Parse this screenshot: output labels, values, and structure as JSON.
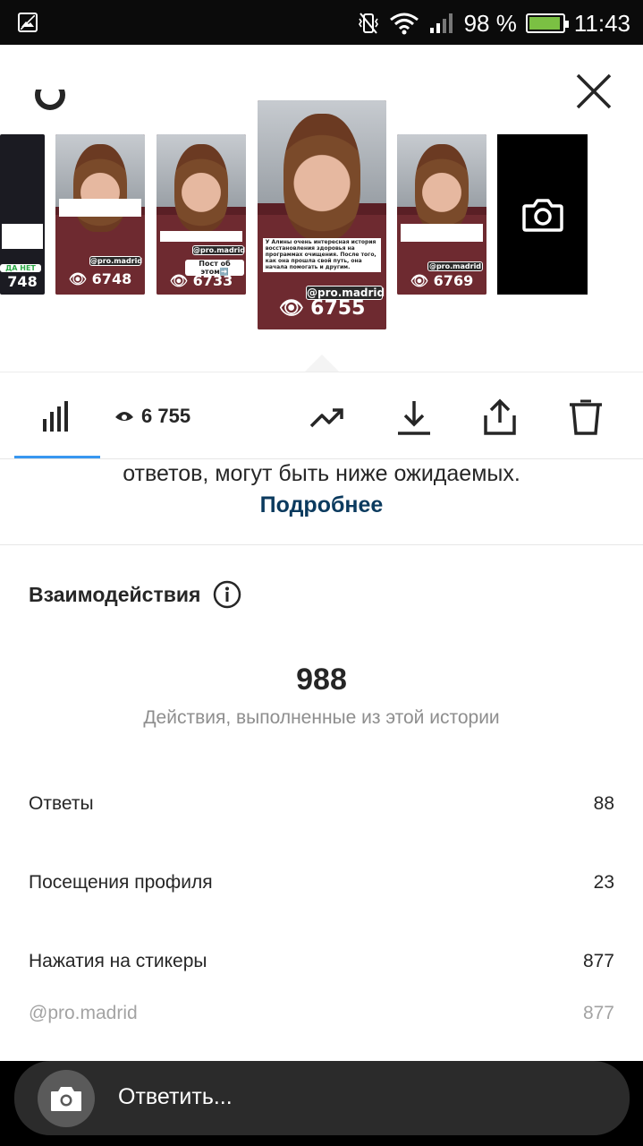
{
  "status_bar": {
    "battery_percent": "98 %",
    "time": "11:43"
  },
  "stories": {
    "thumbs": [
      {
        "views": "748",
        "tag": "",
        "caption": "",
        "buttons": "ДА    НЕТ"
      },
      {
        "views": "6748",
        "tag": "@pro.madrid",
        "caption": "",
        "buttons": ""
      },
      {
        "views": "6733",
        "tag": "@pro.madrid",
        "caption": "",
        "buttons": "Пост об этом➡️"
      },
      {
        "views": "6755",
        "tag": "@pro.madrid",
        "caption": "У Алины очень интересная история восстановления здоровья на программах очищения. После того, как она прошла свой путь, она начала помогать и другим.",
        "buttons": ""
      },
      {
        "views": "6769",
        "tag": "@pro.madrid",
        "caption": "",
        "buttons": ""
      }
    ]
  },
  "toolbar": {
    "views": "6 755",
    "icons": [
      "bar-chart-icon",
      "eye-icon",
      "trending-icon",
      "download-icon",
      "share-icon",
      "trash-icon"
    ]
  },
  "disclaimer": {
    "line1": "ответов, могут быть ниже ожидаемых.",
    "link": "Подробнее"
  },
  "interactions": {
    "title": "Взаимодействия",
    "total": "988",
    "subtitle": "Действия, выполненные из этой истории",
    "rows": [
      {
        "label": "Ответы",
        "value": "88"
      },
      {
        "label": "Посещения профиля",
        "value": "23"
      },
      {
        "label": "Нажатия на стикеры",
        "value": "877"
      },
      {
        "label": "@pro.madrid",
        "value": "877"
      }
    ]
  },
  "reply": {
    "placeholder": "Ответить..."
  },
  "colors": {
    "accent": "#3897f0",
    "link": "#0b3a5e",
    "battery": "#7bc043"
  }
}
